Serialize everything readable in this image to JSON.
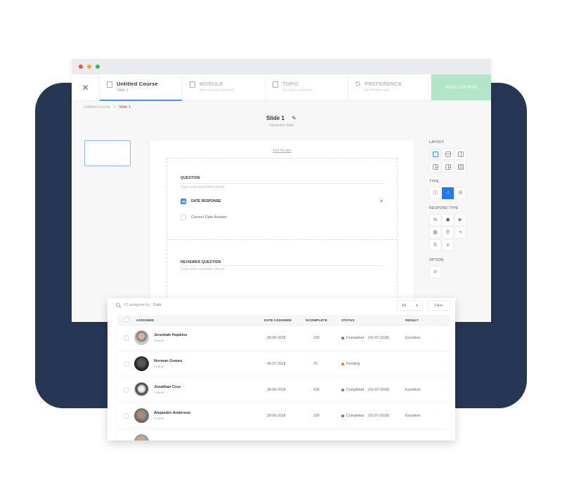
{
  "window": {
    "close_label": "✕",
    "steps": [
      {
        "title": "Untitled Course",
        "subtitle": "Slide 1",
        "icon": "book-icon",
        "active": true
      },
      {
        "title": "MODULE",
        "subtitle": "No module selected",
        "icon": "book-icon",
        "active": false
      },
      {
        "title": "TOPIC",
        "subtitle": "No topic selected",
        "icon": "book-icon",
        "active": false
      },
      {
        "title": "PREFERENCE",
        "subtitle": "No Preference",
        "icon": "gear-icon",
        "active": false
      }
    ],
    "save_label": "SAVE COURSE"
  },
  "breadcrumb": {
    "root": "Untitled Course",
    "separator": ">",
    "current": "Slide 1"
  },
  "slide": {
    "title": "Slide 1",
    "subtitle": "Interaction Slide",
    "edit_icon": "✎"
  },
  "editor": {
    "add_header": "Add Header",
    "question_label": "QUESTION",
    "question_placeholder": "Type your question above",
    "response_type_label": "DATE RESPONSE",
    "remove_icon": "✕",
    "correct_answer_label": "Correct Date Answer",
    "reviewer_label": "REVIEWER QUESTION",
    "reviewer_placeholder": "Type your question above"
  },
  "panel": {
    "layout_label": "LAYOUT",
    "type_label": "TYPE",
    "type_icons": [
      "ⓘ",
      "☝",
      "☰"
    ],
    "respond_label": "RESPOND TYPE",
    "respond_icons": [
      "⇆",
      "◉",
      "▶",
      "▦",
      "☰",
      "≡",
      "⇅",
      "⌀"
    ],
    "option_label": "OPTION",
    "option_icon": "⌀"
  },
  "table": {
    "summary_count": "12 assignee by",
    "summary_sort": "Date",
    "filter_select": "All",
    "filter_button": "Filter",
    "headers": {
      "assigned": "ASSIGNED",
      "date": "DATE ASSIGNED",
      "complete": "%COMPLETE",
      "status": "STATUS",
      "result": "RESULT",
      "more": "···",
      "sort": "↕"
    },
    "rows": [
      {
        "name": "Jeremiah Hopkins",
        "role": "Trainer",
        "date": "28-06-2018",
        "complete": "100",
        "status": "Completed",
        "status_date": "(01-07-2018)",
        "status_color": "#3aa63a",
        "result": "Excellent",
        "more": "···"
      },
      {
        "name": "Norman Gomez",
        "role": "Trainer",
        "date": "05-07-2018",
        "complete": "75",
        "status": "Pending",
        "status_date": "",
        "status_color": "#f07a1e",
        "result": "",
        "more": "···"
      },
      {
        "name": "Jonathan Cruz",
        "role": "Trainer",
        "date": "28-06-2018",
        "complete": "100",
        "status": "Completed",
        "status_date": "(01-07-2018)",
        "status_color": "#3aa63a",
        "result": "Excellent",
        "more": "···"
      },
      {
        "name": "Alejandro Anderson",
        "role": "Trainer",
        "date": "28-06-2018",
        "complete": "100",
        "status": "Completed",
        "status_date": "(01-07-2018)",
        "status_color": "#3aa63a",
        "result": "Excellent",
        "more": "···"
      }
    ]
  },
  "colors": {
    "navy": "#263755",
    "accent_blue": "#1e7cf0",
    "save_green": "#b3e5cb",
    "breadcrumb_red": "#d0363b"
  }
}
